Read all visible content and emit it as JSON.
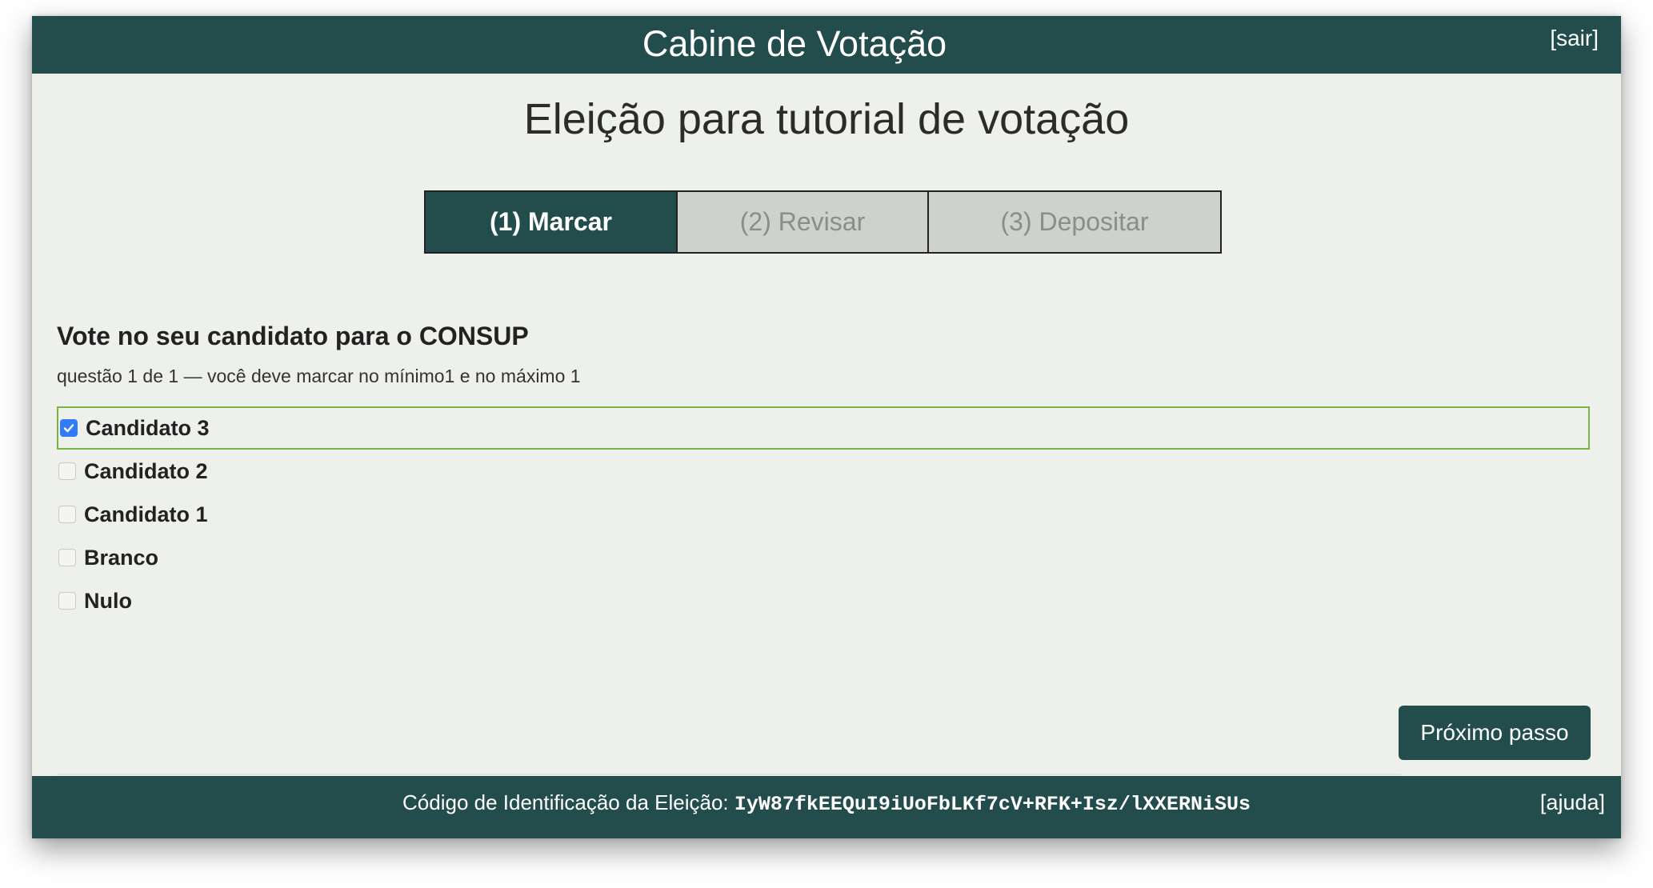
{
  "header": {
    "title": "Cabine de Votação",
    "logout_label": "[sair]"
  },
  "election": {
    "title": "Eleição para tutorial de votação"
  },
  "steps": [
    {
      "label": "(1) Marcar",
      "active": true
    },
    {
      "label": "(2) Revisar",
      "active": false
    },
    {
      "label": "(3) Depositar",
      "active": false
    }
  ],
  "question": {
    "title": "Vote no seu candidato para o CONSUP",
    "subtitle": "questão 1 de 1 — você deve marcar no mínimo1 e no máximo 1",
    "answers": [
      {
        "label": "Candidato 3",
        "checked": true
      },
      {
        "label": "Candidato 2",
        "checked": false
      },
      {
        "label": "Candidato 1",
        "checked": false
      },
      {
        "label": "Branco",
        "checked": false
      },
      {
        "label": "Nulo",
        "checked": false
      }
    ]
  },
  "actions": {
    "next_label": "Próximo passo"
  },
  "footer": {
    "code_label": "Código de Identificação da Eleição:",
    "code_value": "IyW87fkEEQuI9iUoFbLKf7cV+RFK+Isz/lXXERNiSUs",
    "help_label": "[ajuda]"
  },
  "colors": {
    "brand": "#224d4c",
    "background": "#eef0ec",
    "selected_border": "#7cb342",
    "checkbox_checked": "#2f7cf6"
  }
}
